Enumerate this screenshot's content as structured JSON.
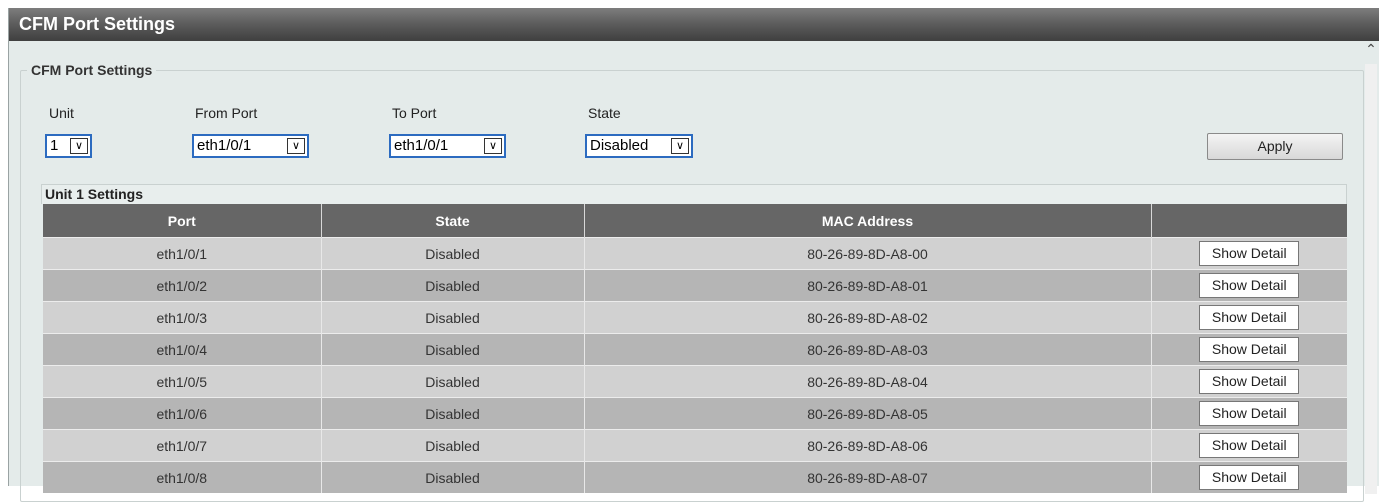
{
  "page": {
    "title": "CFM Port Settings"
  },
  "group": {
    "legend": "CFM Port Settings",
    "unit_label": "Unit",
    "unit_value": "1",
    "from_port_label": "From Port",
    "from_port_value": "eth1/0/1",
    "to_port_label": "To Port",
    "to_port_value": "eth1/0/1",
    "state_label": "State",
    "state_value": "Disabled",
    "apply_label": "Apply"
  },
  "unit_settings": {
    "title": "Unit 1 Settings",
    "columns": [
      "Port",
      "State",
      "MAC Address",
      ""
    ],
    "rows": [
      {
        "port": "eth1/0/1",
        "state": "Disabled",
        "mac": "80-26-89-8D-A8-00",
        "action": "Show Detail"
      },
      {
        "port": "eth1/0/2",
        "state": "Disabled",
        "mac": "80-26-89-8D-A8-01",
        "action": "Show Detail"
      },
      {
        "port": "eth1/0/3",
        "state": "Disabled",
        "mac": "80-26-89-8D-A8-02",
        "action": "Show Detail"
      },
      {
        "port": "eth1/0/4",
        "state": "Disabled",
        "mac": "80-26-89-8D-A8-03",
        "action": "Show Detail"
      },
      {
        "port": "eth1/0/5",
        "state": "Disabled",
        "mac": "80-26-89-8D-A8-04",
        "action": "Show Detail"
      },
      {
        "port": "eth1/0/6",
        "state": "Disabled",
        "mac": "80-26-89-8D-A8-05",
        "action": "Show Detail"
      },
      {
        "port": "eth1/0/7",
        "state": "Disabled",
        "mac": "80-26-89-8D-A8-06",
        "action": "Show Detail"
      },
      {
        "port": "eth1/0/8",
        "state": "Disabled",
        "mac": "80-26-89-8D-A8-07",
        "action": "Show Detail"
      }
    ]
  },
  "icons": {
    "dropdown": "chevron-down-icon",
    "scroll_up": "chevron-up-icon"
  }
}
